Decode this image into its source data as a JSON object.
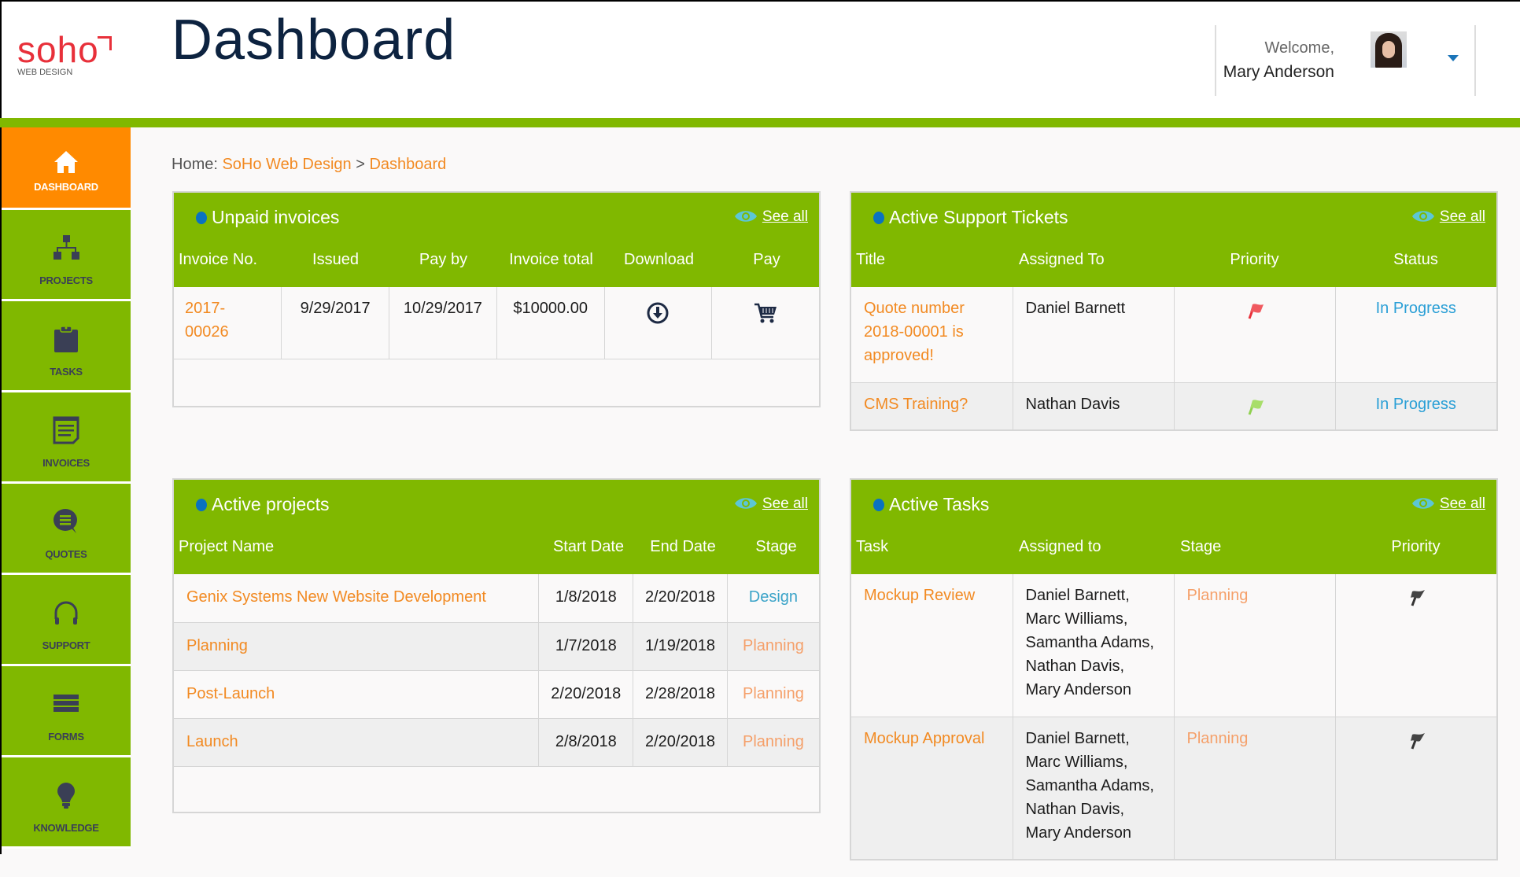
{
  "header": {
    "logo_word": "soho",
    "logo_sub": "WEB DESIGN",
    "page_title": "Dashboard",
    "welcome": "Welcome,",
    "user_name": "Mary Anderson"
  },
  "colors": {
    "green": "#80b800",
    "orange": "#ff8a00",
    "link_orange": "#f28a22",
    "status_blue": "#2a9fd6",
    "title_navy": "#0d2340",
    "logo_red": "#e8303a"
  },
  "sidebar": {
    "items": [
      {
        "label": "DASHBOARD",
        "icon": "home-icon",
        "active": true
      },
      {
        "label": "PROJECTS",
        "icon": "sitemap-icon"
      },
      {
        "label": "TASKS",
        "icon": "clipboard-icon"
      },
      {
        "label": "INVOICES",
        "icon": "invoice-icon"
      },
      {
        "label": "QUOTES",
        "icon": "chat-bubble-icon"
      },
      {
        "label": "SUPPORT",
        "icon": "headphones-icon"
      },
      {
        "label": "FORMS",
        "icon": "list-bars-icon"
      },
      {
        "label": "KNOWLEDGE",
        "icon": "lightbulb-icon"
      }
    ]
  },
  "breadcrumb": {
    "prefix": "Home:",
    "items": [
      "SoHo Web Design",
      "Dashboard"
    ],
    "separator": ">"
  },
  "invoices": {
    "title": "Unpaid invoices",
    "see_all": "See all",
    "columns": [
      "Invoice No.",
      "Issued",
      "Pay by",
      "Invoice total",
      "Download",
      "Pay"
    ],
    "rows": [
      {
        "invoice_no": "2017-00026",
        "issued": "9/29/2017",
        "pay_by": "10/29/2017",
        "total": "$10000.00",
        "download_icon": "download-circle-icon",
        "pay_icon": "cart-icon"
      }
    ]
  },
  "tickets": {
    "title": "Active Support Tickets",
    "see_all": "See all",
    "columns": [
      "Title",
      "Assigned To",
      "Priority",
      "Status"
    ],
    "rows": [
      {
        "title": "Quote number 2018-00001 is approved!",
        "assigned": "Daniel Barnett",
        "priority": "high",
        "priority_color": "#e8303a",
        "status": "In Progress"
      },
      {
        "title": "CMS Training?",
        "assigned": "Nathan Davis",
        "priority": "low",
        "priority_color": "#8fd14f",
        "status": "In Progress"
      }
    ]
  },
  "projects": {
    "title": "Active projects",
    "see_all": "See all",
    "columns": [
      "Project Name",
      "Start Date",
      "End Date",
      "Stage"
    ],
    "rows": [
      {
        "name": "Genix Systems New Website Development",
        "start": "1/8/2018",
        "end": "2/20/2018",
        "stage": "Design"
      },
      {
        "name": "Planning",
        "start": "1/7/2018",
        "end": "1/19/2018",
        "stage": "Planning"
      },
      {
        "name": "Post-Launch",
        "start": "2/20/2018",
        "end": "2/28/2018",
        "stage": "Planning"
      },
      {
        "name": "Launch",
        "start": "2/8/2018",
        "end": "2/20/2018",
        "stage": "Planning"
      }
    ]
  },
  "tasks": {
    "title": "Active Tasks",
    "see_all": "See all",
    "columns": [
      "Task",
      "Assigned to",
      "Stage",
      "Priority"
    ],
    "rows": [
      {
        "task": "Mockup Review",
        "assigned": [
          "Daniel Barnett,",
          "Marc Williams,",
          "Samantha Adams,",
          "Nathan Davis,",
          "Mary Anderson"
        ],
        "stage": "Planning",
        "priority": "normal",
        "priority_color": "#333333"
      },
      {
        "task": "Mockup Approval",
        "assigned": [
          "Daniel Barnett,",
          "Marc Williams,",
          "Samantha Adams,",
          "Nathan Davis,",
          "Mary Anderson"
        ],
        "stage": "Planning",
        "priority": "normal",
        "priority_color": "#333333"
      }
    ]
  }
}
